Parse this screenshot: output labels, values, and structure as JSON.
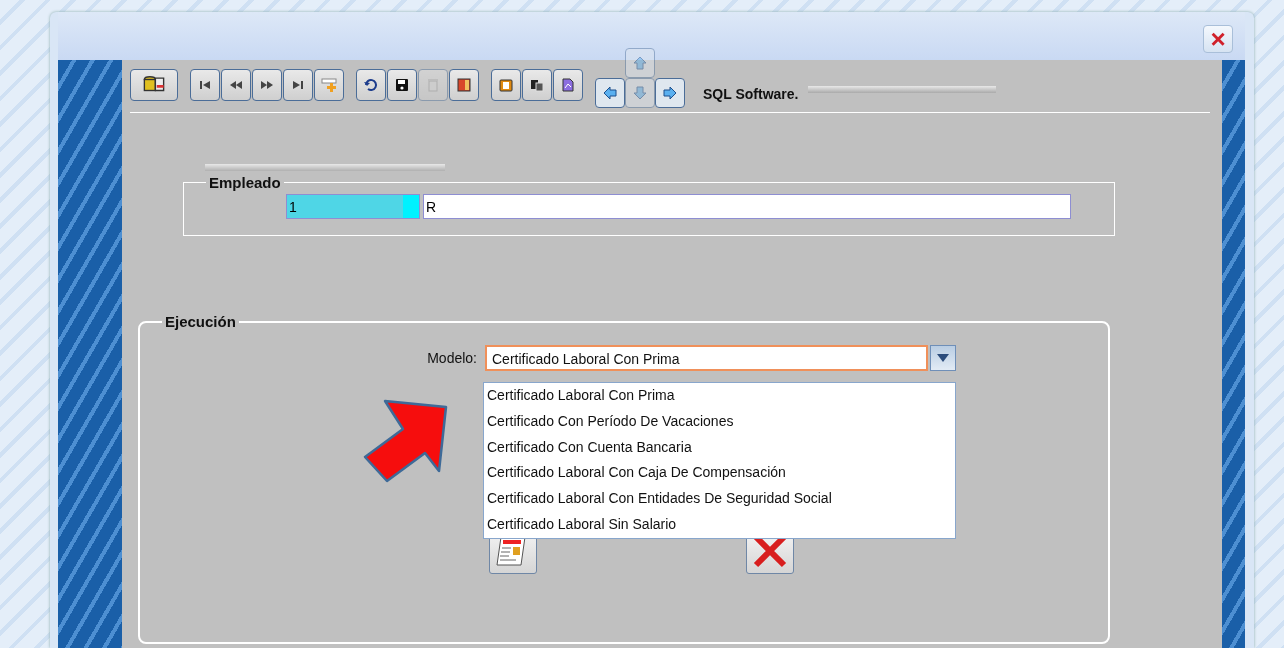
{
  "window": {
    "close_button": "×"
  },
  "toolbar": {
    "groups": [
      [
        {
          "kind": "db-export",
          "disabled": false
        }
      ],
      [
        {
          "kind": "first",
          "disabled": false
        },
        {
          "kind": "prev",
          "disabled": false
        },
        {
          "kind": "next",
          "disabled": false
        },
        {
          "kind": "last",
          "disabled": false
        },
        {
          "kind": "insert",
          "disabled": false
        }
      ],
      [
        {
          "kind": "undo",
          "disabled": false
        },
        {
          "kind": "save",
          "disabled": false
        },
        {
          "kind": "delete",
          "disabled": true
        },
        {
          "kind": "exit",
          "disabled": false
        }
      ],
      [
        {
          "kind": "clipboard",
          "disabled": false
        },
        {
          "kind": "copy",
          "disabled": false
        },
        {
          "kind": "document",
          "disabled": false
        }
      ]
    ],
    "navigation": [
      {
        "kind": "up",
        "disabled": true
      },
      {
        "kind": "left",
        "disabled": false
      },
      {
        "kind": "down",
        "disabled": true
      },
      {
        "kind": "right",
        "disabled": false
      }
    ],
    "app_label": "SQL Software."
  },
  "empleado": {
    "legend": "Empleado",
    "code": "1",
    "name": "R"
  },
  "ejecucion": {
    "legend": "Ejecución",
    "model_label": "Modelo:",
    "model_value": "Certificado Laboral Con Prima",
    "expanded": true,
    "options": [
      {
        "label": "Certificado Laboral Con Prima",
        "selected": false
      },
      {
        "label": "Certificado Con Período De Vacaciones",
        "selected": false
      },
      {
        "label": "Certificado Con Cuenta Bancaria",
        "selected": false
      },
      {
        "label": "Certificado Laboral Con Caja De Compensación",
        "selected": false
      },
      {
        "label": "Certificado Laboral Con Entidades De Seguridad Social",
        "selected": false
      },
      {
        "label": "Certificado Laboral Sin Salario",
        "selected": false
      }
    ],
    "buttons": [
      {
        "kind": "report"
      },
      {
        "kind": "cancel"
      }
    ]
  }
}
